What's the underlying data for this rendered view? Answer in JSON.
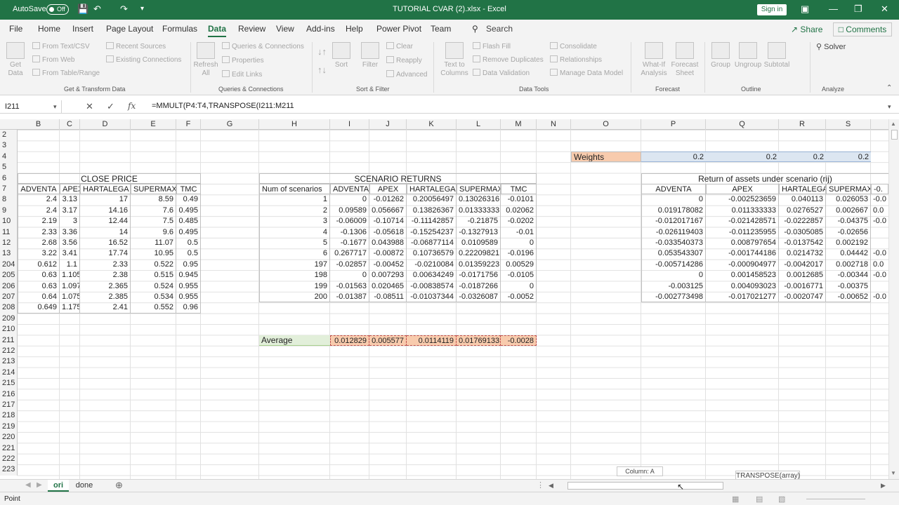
{
  "titlebar": {
    "autosave": "AutoSave",
    "autosave_state": "Off",
    "title": "TUTORIAL CVAR (2).xlsx  -  Excel",
    "signin": "Sign in"
  },
  "tabs": [
    "File",
    "Home",
    "Insert",
    "Page Layout",
    "Formulas",
    "Data",
    "Review",
    "View",
    "Add-ins",
    "Help",
    "Power Pivot",
    "Team"
  ],
  "search": "Search",
  "share": "Share",
  "comments": "Comments",
  "ribbon": {
    "get_data": "Get\nData",
    "from_text": "From Text/CSV",
    "from_web": "From Web",
    "from_table": "From Table/Range",
    "recent": "Recent Sources",
    "existing": "Existing Connections",
    "refresh": "Refresh\nAll",
    "queries": "Queries & Connections",
    "properties": "Properties",
    "edit_links": "Edit Links",
    "sort": "Sort",
    "filter": "Filter",
    "clear": "Clear",
    "reapply": "Reapply",
    "advanced": "Advanced",
    "text_cols": "Text to\nColumns",
    "flash": "Flash Fill",
    "remove_dup": "Remove Duplicates",
    "validation": "Data Validation",
    "consolidate": "Consolidate",
    "relationships": "Relationships",
    "manage_model": "Manage Data Model",
    "whatif": "What-If\nAnalysis",
    "forecast_sheet": "Forecast\nSheet",
    "group": "Group",
    "ungroup": "Ungroup",
    "subtotal": "Subtotal",
    "solver": "Solver",
    "groups": [
      "Get & Transform Data",
      "Queries & Connections",
      "Sort & Filter",
      "Data Tools",
      "Forecast",
      "Outline",
      "Analyze"
    ]
  },
  "namebox": "I211",
  "formula": "=MMULT(P4:T4,TRANSPOSE(I211:M211",
  "columns": [
    "B",
    "C",
    "D",
    "E",
    "F",
    "G",
    "H",
    "I",
    "J",
    "K",
    "L",
    "M",
    "N",
    "O",
    "P",
    "Q",
    "R",
    "S"
  ],
  "rows": [
    "2",
    "3",
    "4",
    "5",
    "6",
    "7",
    "8",
    "9",
    "10",
    "11",
    "12",
    "13",
    "204",
    "205",
    "206",
    "207",
    "208",
    "209",
    "210",
    "211",
    "212",
    "213",
    "214",
    "215",
    "216",
    "217",
    "218",
    "219",
    "220",
    "221",
    "222",
    "223"
  ],
  "weights": {
    "label": "Weights",
    "values": [
      "0.2",
      "0.2",
      "0.2",
      "0.2"
    ]
  },
  "close": {
    "title": "CLOSE PRICE",
    "headers": [
      "ADVENTA",
      "APEX",
      "HARTALEGA",
      "SUPERMAX",
      "TMC"
    ],
    "rows": [
      [
        "2.4",
        "3.13",
        "17",
        "8.59",
        "0.49"
      ],
      [
        "2.4",
        "3.17",
        "14.16",
        "7.6",
        "0.495"
      ],
      [
        "2.19",
        "3",
        "12.44",
        "7.5",
        "0.485"
      ],
      [
        "2.33",
        "3.36",
        "14",
        "9.6",
        "0.495"
      ],
      [
        "2.68",
        "3.56",
        "16.52",
        "11.07",
        "0.5"
      ],
      [
        "3.22",
        "3.41",
        "17.74",
        "10.95",
        "0.5"
      ],
      [
        "0.612",
        "1.1",
        "2.33",
        "0.522",
        "0.95"
      ],
      [
        "0.63",
        "1.105",
        "2.38",
        "0.515",
        "0.945"
      ],
      [
        "0.63",
        "1.097",
        "2.365",
        "0.524",
        "0.955"
      ],
      [
        "0.64",
        "1.075",
        "2.385",
        "0.534",
        "0.955"
      ],
      [
        "0.649",
        "1.175",
        "2.41",
        "0.552",
        "0.96"
      ]
    ]
  },
  "scenario": {
    "title": "SCENARIO RETURNS",
    "headers": [
      "Num of scenarios",
      "ADVENTA",
      "APEX",
      "HARTALEGA",
      "SUPERMAX",
      "TMC"
    ],
    "rows": [
      [
        "1",
        "0",
        "-0.01262",
        "0.20056497",
        "0.13026316",
        "-0.0101"
      ],
      [
        "2",
        "0.09589",
        "0.056667",
        "0.13826367",
        "0.01333333",
        "0.02062"
      ],
      [
        "3",
        "-0.06009",
        "-0.10714",
        "-0.11142857",
        "-0.21875",
        "-0.0202"
      ],
      [
        "4",
        "-0.1306",
        "-0.05618",
        "-0.15254237",
        "-0.1327913",
        "-0.01"
      ],
      [
        "5",
        "-0.1677",
        "0.043988",
        "-0.06877114",
        "0.0109589",
        "0"
      ],
      [
        "6",
        "0.267717",
        "-0.00872",
        "0.10736579",
        "0.22209821",
        "-0.0196"
      ],
      [
        "197",
        "-0.02857",
        "-0.00452",
        "-0.0210084",
        "0.01359223",
        "0.00529"
      ],
      [
        "198",
        "0",
        "0.007293",
        "0.00634249",
        "-0.0171756",
        "-0.0105"
      ],
      [
        "199",
        "-0.01563",
        "0.020465",
        "-0.00838574",
        "-0.0187266",
        "0"
      ],
      [
        "200",
        "-0.01387",
        "-0.08511",
        "-0.01037344",
        "-0.0326087",
        "-0.0052"
      ]
    ],
    "avg_label": "Average",
    "avg": [
      "0.012829",
      "0.005577",
      "0.0114119",
      "0.01769133",
      "-0.0028"
    ]
  },
  "rij": {
    "title": "Return of assets under scenario  (rij)",
    "headers": [
      "ADVENTA",
      "APEX",
      "HARTALEGA",
      "SUPERMAX",
      "-0."
    ],
    "rows": [
      [
        "0",
        "-0.002523659",
        "0.040113",
        "0.026053",
        "-0.0"
      ],
      [
        "0.019178082",
        "0.011333333",
        "0.0276527",
        "0.002667",
        "0.0"
      ],
      [
        "-0.012017167",
        "-0.021428571",
        "-0.0222857",
        "-0.04375",
        "-0.0"
      ],
      [
        "-0.026119403",
        "-0.011235955",
        "-0.0305085",
        "-0.02656",
        ""
      ],
      [
        "-0.033540373",
        "0.008797654",
        "-0.0137542",
        "0.002192",
        ""
      ],
      [
        "0.053543307",
        "-0.001744186",
        "0.0214732",
        "0.04442",
        "-0.0"
      ],
      [
        "-0.005714286",
        "-0.000904977",
        "-0.0042017",
        "0.002718",
        "0.0"
      ],
      [
        "0",
        "0.001458523",
        "0.0012685",
        "-0.00344",
        "-0.0"
      ],
      [
        "-0.003125",
        "0.004093023",
        "-0.0016771",
        "-0.00375",
        ""
      ],
      [
        "-0.002773498",
        "-0.017021277",
        "-0.0020747",
        "-0.00652",
        "-0.0"
      ]
    ]
  },
  "tooltip": "TRANSPOSE(array)",
  "coltip": "Column: A",
  "sheets": [
    "ori",
    "done"
  ],
  "status": "Point"
}
